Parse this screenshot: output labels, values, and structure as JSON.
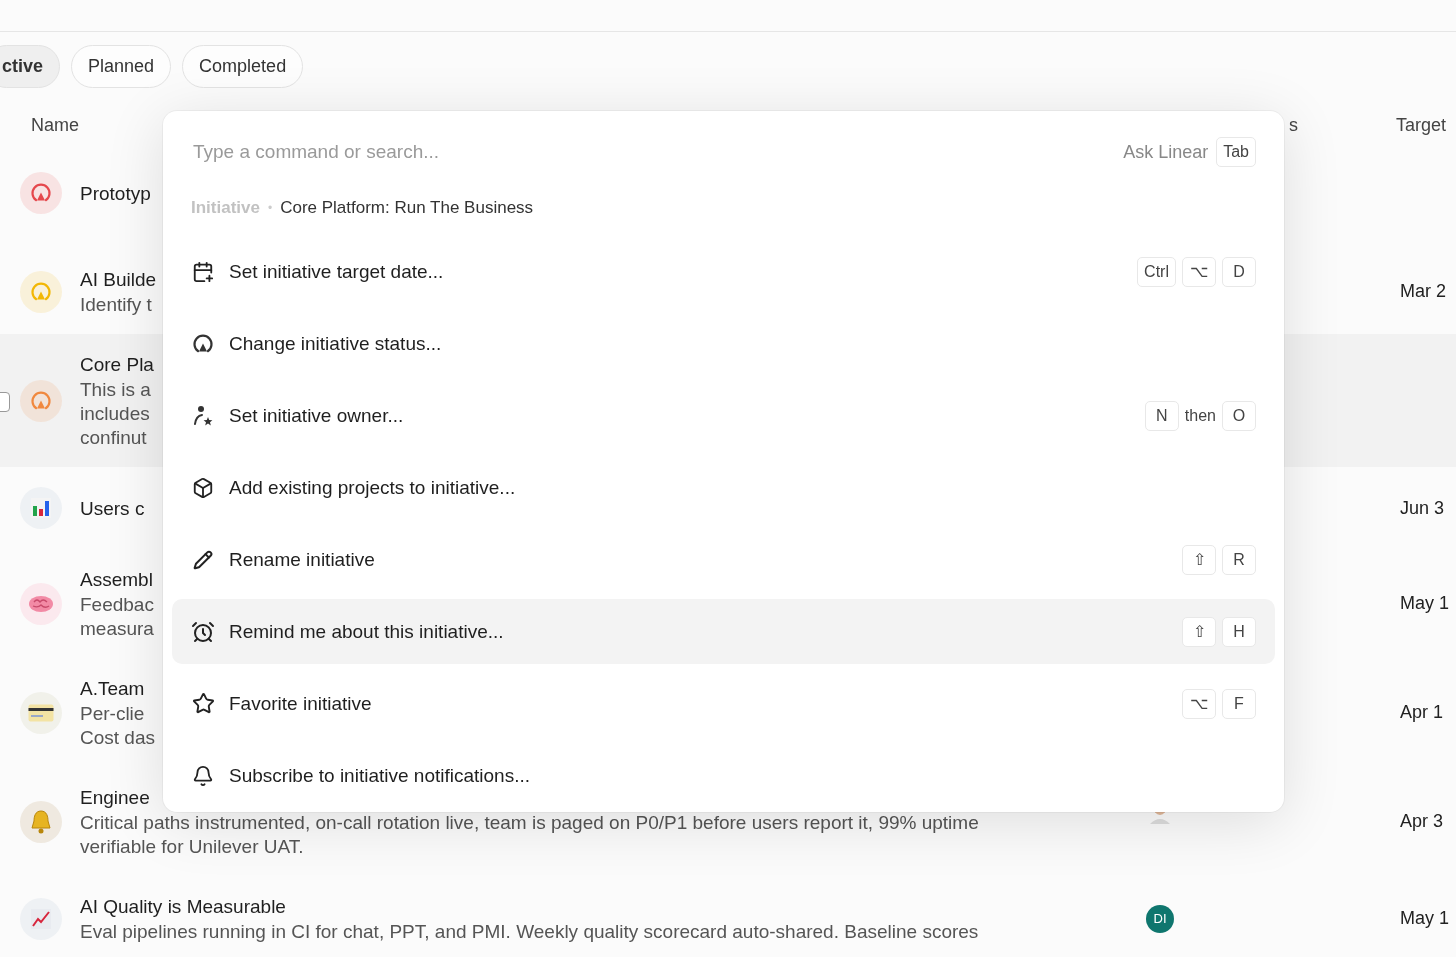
{
  "filters": [
    {
      "label": "ctive",
      "selected": true
    },
    {
      "label": "Planned",
      "selected": false
    },
    {
      "label": "Completed",
      "selected": false
    }
  ],
  "table": {
    "columns": [
      {
        "label": "Name"
      },
      {
        "label": "s"
      },
      {
        "label": "Target"
      }
    ],
    "rows": [
      {
        "icon": {
          "kind": "status",
          "color": "#e5484d"
        },
        "title": "Prototyp",
        "description": [],
        "hovered": false
      },
      {
        "icon": {
          "kind": "status",
          "color": "#f2b705"
        },
        "title": "AI Builde",
        "description": [
          "Identify t"
        ],
        "date": "Mar 2",
        "hovered": false
      },
      {
        "icon": {
          "kind": "status",
          "color": "#f0883e"
        },
        "title": "Core Pla",
        "description": [
          "This is a",
          "includes",
          "confinut"
        ],
        "hovered": true
      },
      {
        "icon": {
          "kind": "chart"
        },
        "title": "Users c",
        "description": [],
        "date": "Jun 3",
        "hovered": false
      },
      {
        "icon": {
          "kind": "brain"
        },
        "title": "Assembl",
        "description": [
          "Feedbac",
          "measura"
        ],
        "date": "May 1",
        "hovered": false
      },
      {
        "icon": {
          "kind": "card"
        },
        "title": "A.Team",
        "description": [
          "Per-clie",
          "Cost das"
        ],
        "date": "Apr 1",
        "hovered": false
      },
      {
        "icon": {
          "kind": "bell"
        },
        "title": "Enginee",
        "description": [
          "Critical paths instrumented, on-call rotation live, team is paged on P0/P1 before users report it, 99% uptime",
          "verifiable for Unilever UAT."
        ],
        "owner": {
          "kind": "photo"
        },
        "date": "Apr 3",
        "hovered": false
      },
      {
        "icon": {
          "kind": "trend"
        },
        "title": "AI Quality is Measurable",
        "description": [
          "Eval pipelines running in CI for chat, PPT, and PMI. Weekly quality scorecard auto-shared. Baseline scores"
        ],
        "owner": {
          "kind": "initials",
          "initials": "DI",
          "color": "#0f766e"
        },
        "date": "May 1",
        "hovered": false
      }
    ]
  },
  "command_menu": {
    "search": {
      "placeholder": "Type a command or search..."
    },
    "ask": {
      "label": "Ask Linear",
      "key": "Tab"
    },
    "context": {
      "type": "Initiative",
      "separator": "•",
      "name": "Core Platform: Run The Business"
    },
    "items": [
      {
        "label": "Set initiative target date...",
        "shortcut": [
          {
            "kind": "key",
            "text": "Ctrl"
          },
          {
            "kind": "key",
            "text": "⌥"
          },
          {
            "kind": "key",
            "text": "D"
          }
        ],
        "selected": false
      },
      {
        "label": "Change initiative status...",
        "selected": false
      },
      {
        "label": "Set initiative owner...",
        "shortcut": [
          {
            "kind": "key",
            "text": "N"
          },
          {
            "kind": "word",
            "text": "then"
          },
          {
            "kind": "key",
            "text": "O"
          }
        ],
        "selected": false
      },
      {
        "label": "Add existing projects to initiative...",
        "selected": false
      },
      {
        "label": "Rename initiative",
        "shortcut": [
          {
            "kind": "key",
            "text": "⇧"
          },
          {
            "kind": "key",
            "text": "R"
          }
        ],
        "selected": false
      },
      {
        "label": "Remind me about this initiative...",
        "shortcut": [
          {
            "kind": "key",
            "text": "⇧"
          },
          {
            "kind": "key",
            "text": "H"
          }
        ],
        "selected": true
      },
      {
        "label": "Favorite initiative",
        "shortcut": [
          {
            "kind": "key",
            "text": "⌥"
          },
          {
            "kind": "key",
            "text": "F"
          }
        ],
        "selected": false
      },
      {
        "label": "Subscribe to initiative notifications...",
        "selected": false
      }
    ]
  }
}
